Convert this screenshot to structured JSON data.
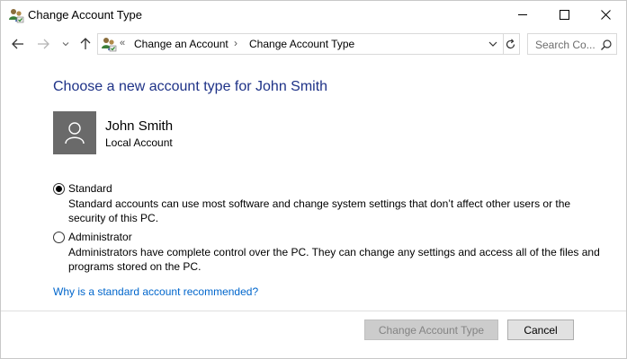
{
  "window": {
    "title": "Change Account Type",
    "controls": {
      "minimize": "minimize",
      "maximize": "maximize",
      "close": "close"
    }
  },
  "navigation": {
    "back_icon": "arrow-left-icon",
    "forward_icon": "arrow-right-icon",
    "recent_icon": "chevron-down-icon",
    "up_icon": "arrow-up-icon"
  },
  "address": {
    "overflow": "«",
    "segments": [
      "Change an Account",
      "Change Account Type"
    ],
    "separator": "›",
    "refresh_icon": "refresh-icon"
  },
  "search": {
    "placeholder": "Search Co..."
  },
  "content": {
    "heading": "Choose a new account type for John Smith",
    "user": {
      "name": "John Smith",
      "account_type": "Local Account"
    },
    "options": [
      {
        "label": "Standard",
        "description": "Standard accounts can use most software and change system settings that don’t affect other users or the security of this PC.",
        "selected": true
      },
      {
        "label": "Administrator",
        "description": "Administrators have complete control over the PC. They can change any settings and access all of the files and programs stored on the PC.",
        "selected": false
      }
    ],
    "help_link": "Why is a standard account recommended?"
  },
  "buttons": {
    "change": "Change Account Type",
    "cancel": "Cancel"
  },
  "colors": {
    "heading": "#1e3287",
    "link": "#0066cc",
    "avatar_bg": "#6a6a6a",
    "disabled_text": "#838383"
  }
}
